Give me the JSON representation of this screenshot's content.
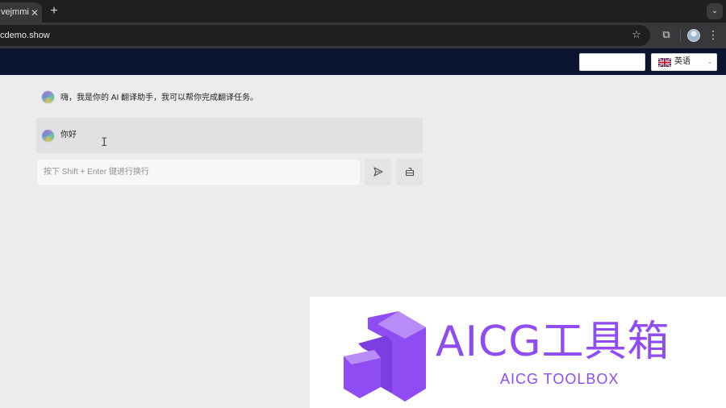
{
  "browser": {
    "tab_title": "vejmmi",
    "tab_close_glyph": "✕",
    "new_tab_glyph": "+",
    "tab_menu_glyph": "⌄",
    "url": "cdemo.show",
    "star_glyph": "☆",
    "extensions_glyph": "⧉",
    "menu_glyph": "⋮"
  },
  "header": {
    "language_label": "英语",
    "language_caret": "⌄",
    "flag_icon": "uk-flag-icon",
    "bg_color": "#0b1430"
  },
  "chat": {
    "assistant_message": "嗨，我是你的 AI 翻译助手，我可以帮你完成翻译任务。",
    "user_message": "你好",
    "input_placeholder": "按下 Shift + Enter 键进行换行",
    "cursor_glyph": "I"
  },
  "watermark": {
    "title": "AICG工具箱",
    "subtitle": "AICG TOOLBOX",
    "color": "#8f4cf2"
  }
}
